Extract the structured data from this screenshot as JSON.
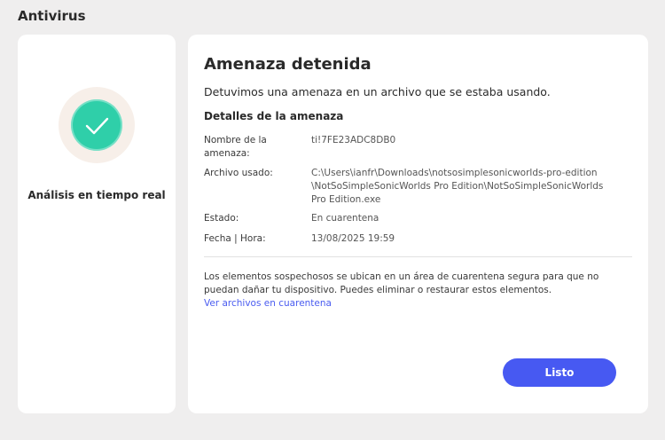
{
  "app": {
    "title": "Antivirus"
  },
  "status": {
    "label": "Análisis en tiempo real",
    "accent": "#2fcfa9",
    "icon": "checkmark-icon"
  },
  "threat": {
    "title": "Amenaza detenida",
    "description": "Detuvimos una amenaza en un archivo que se estaba usando.",
    "details_heading": "Detalles de la amenaza",
    "details": [
      {
        "label": "Nombre de la amenaza:",
        "value": "ti!7FE23ADC8DB0"
      },
      {
        "label": "Archivo usado:",
        "value": "C:\\Users\\ianfr\\Downloads\\notsosimplesonicworlds-pro-edition\\NotSoSimpleSonicWorlds Pro Edition\\NotSoSimpleSonicWorlds Pro Edition.exe"
      },
      {
        "label": "Estado:",
        "value": "En cuarentena"
      },
      {
        "label": "Fecha | Hora:",
        "value": "13/08/2025 19:59"
      }
    ],
    "note": "Los elementos sospechosos se ubican en un área de cuarentena segura para que no puedan dañar tu dispositivo. Puedes eliminar o restaurar estos elementos.",
    "quarantine_link": "Ver archivos en cuarentena",
    "done_label": "Listo",
    "button_color": "#4759f2"
  }
}
